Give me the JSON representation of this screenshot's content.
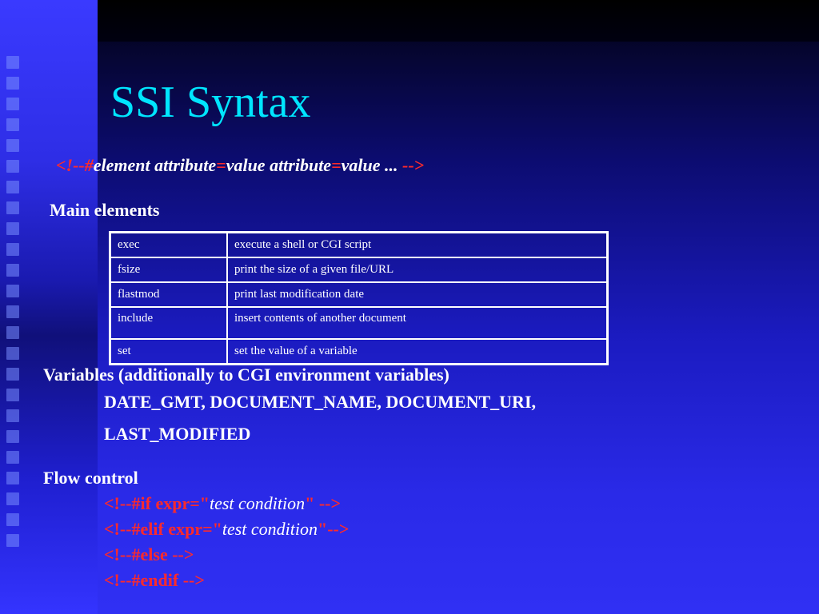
{
  "title": "SSI Syntax",
  "syntax": {
    "open": "<!--#",
    "element": "element",
    "attr1": " attribute",
    "eq1": "=",
    "value1": "value attribute",
    "eq2": "=",
    "value2": "value ...",
    "close": " -->"
  },
  "main_label": "Main elements",
  "elements": [
    {
      "name": "exec",
      "description": "execute a shell or CGI script"
    },
    {
      "name": "fsize",
      "description": "print the size of a given file/URL"
    },
    {
      "name": "flastmod",
      "description": "print last modification date"
    },
    {
      "name": "include",
      "description": "insert contents of another document"
    },
    {
      "name": "set",
      "description": "set the value of a variable"
    }
  ],
  "variables": {
    "label": "Variables (additionally to CGI environment variables)",
    "line1": "DATE_GMT, DOCUMENT_NAME, DOCUMENT_URI,",
    "line2": "LAST_MODIFIED"
  },
  "flow": {
    "label": "Flow control",
    "if_open": "<!--#if expr=\"",
    "if_cond": "test condition",
    "if_close": "\" -->",
    "elif_open": "<!--#elif expr=\"",
    "elif_cond": "test condition",
    "elif_close": "\"-->",
    "else": "<!--#else -->",
    "endif": "<!--#endif -->"
  },
  "colors": {
    "title": "#00e5ff",
    "keyword": "#ff2a2a",
    "text": "#ffffff"
  }
}
